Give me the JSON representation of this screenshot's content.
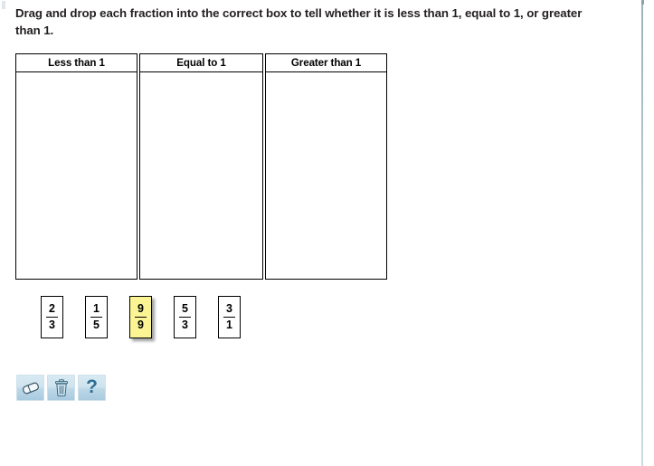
{
  "prompt": {
    "text": "Drag and drop each fraction into the correct box to tell whether it is less than 1, equal to 1, or greater than 1."
  },
  "board": {
    "columns": [
      {
        "label": "Less than 1",
        "items": []
      },
      {
        "label": "Equal to 1",
        "items": []
      },
      {
        "label": "Greater than 1",
        "items": []
      }
    ]
  },
  "tray": {
    "tiles": [
      {
        "numerator": "2",
        "denominator": "3",
        "selected": false
      },
      {
        "numerator": "1",
        "denominator": "5",
        "selected": false
      },
      {
        "numerator": "9",
        "denominator": "9",
        "selected": true
      },
      {
        "numerator": "5",
        "denominator": "3",
        "selected": false
      },
      {
        "numerator": "3",
        "denominator": "1",
        "selected": false
      }
    ]
  },
  "toolbar": {
    "buttons": [
      {
        "name": "eraser-button",
        "icon": "eraser-icon",
        "label": ""
      },
      {
        "name": "trash-button",
        "icon": "trash-icon",
        "label": ""
      },
      {
        "name": "help-button",
        "icon": "question-mark-icon",
        "label": "?"
      }
    ]
  },
  "colors": {
    "selected_tile": "#fbf495",
    "tool_button_top": "#d8eaf3",
    "tool_button_bottom": "#a9cadf",
    "divider": "#9ab3bc",
    "text": "#231f20"
  }
}
